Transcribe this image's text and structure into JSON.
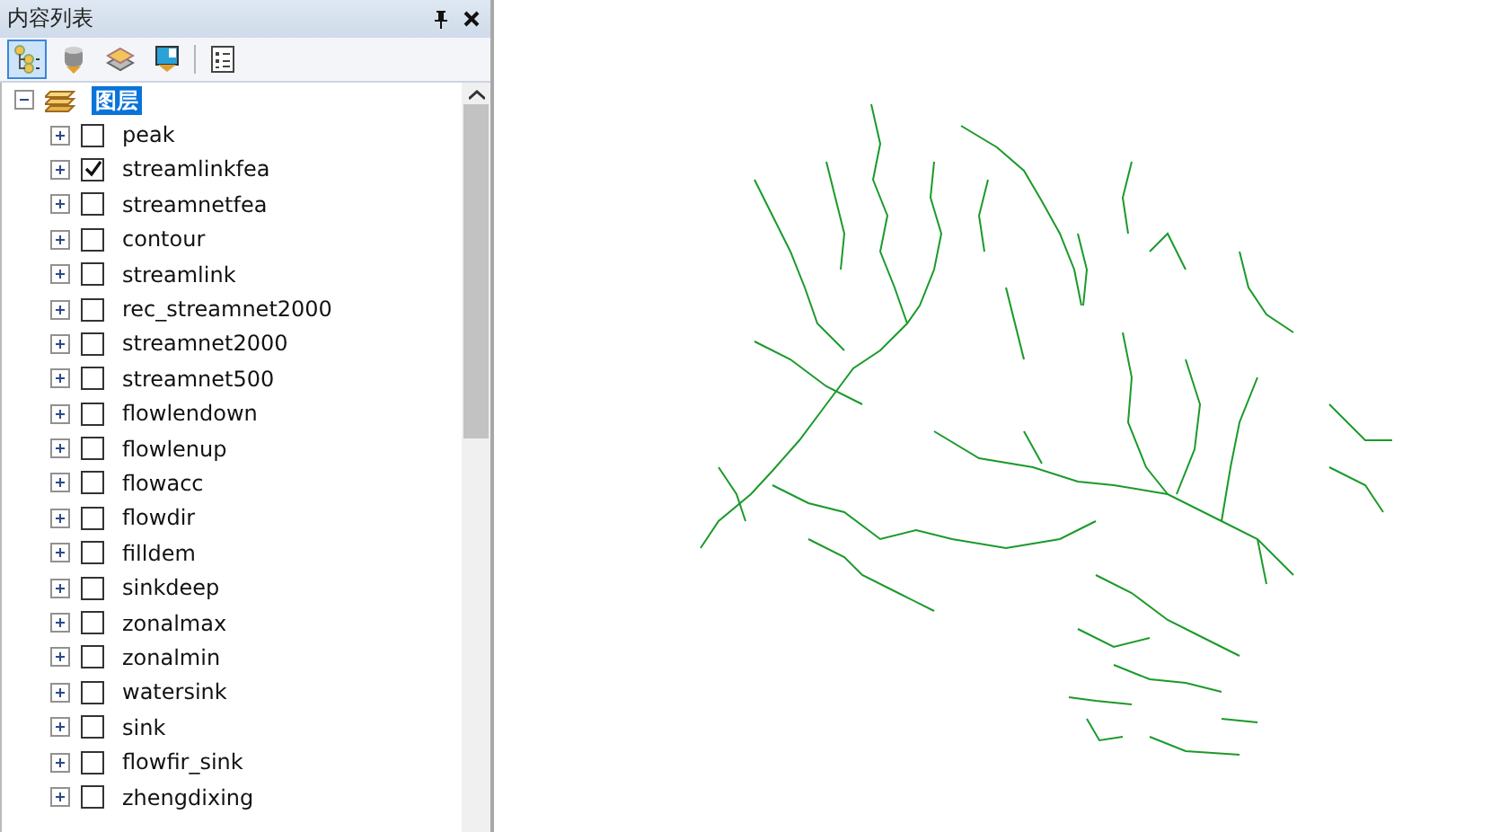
{
  "panel": {
    "title": "内容列表"
  },
  "tree": {
    "label": "图层",
    "expanded": true,
    "selected": true,
    "children": [
      {
        "label": "peak",
        "checked": false,
        "expanded": false
      },
      {
        "label": "streamlinkfea",
        "checked": true,
        "expanded": false
      },
      {
        "label": "streamnetfea",
        "checked": false,
        "expanded": false
      },
      {
        "label": "contour",
        "checked": false,
        "expanded": false
      },
      {
        "label": "streamlink",
        "checked": false,
        "expanded": false
      },
      {
        "label": "rec_streamnet2000",
        "checked": false,
        "expanded": false
      },
      {
        "label": "streamnet2000",
        "checked": false,
        "expanded": false
      },
      {
        "label": "streamnet500",
        "checked": false,
        "expanded": false
      },
      {
        "label": "flowlendown",
        "checked": false,
        "expanded": false
      },
      {
        "label": "flowlenup",
        "checked": false,
        "expanded": false
      },
      {
        "label": "flowacc",
        "checked": false,
        "expanded": false
      },
      {
        "label": "flowdir",
        "checked": false,
        "expanded": false
      },
      {
        "label": "filldem",
        "checked": false,
        "expanded": false
      },
      {
        "label": "sinkdeep",
        "checked": false,
        "expanded": false
      },
      {
        "label": "zonalmax",
        "checked": false,
        "expanded": false
      },
      {
        "label": "zonalmin",
        "checked": false,
        "expanded": false
      },
      {
        "label": "watersink",
        "checked": false,
        "expanded": false
      },
      {
        "label": "sink",
        "checked": false,
        "expanded": false
      },
      {
        "label": "flowfir_sink",
        "checked": false,
        "expanded": false
      },
      {
        "label": "zhengdixing",
        "checked": false,
        "expanded": false
      }
    ]
  }
}
